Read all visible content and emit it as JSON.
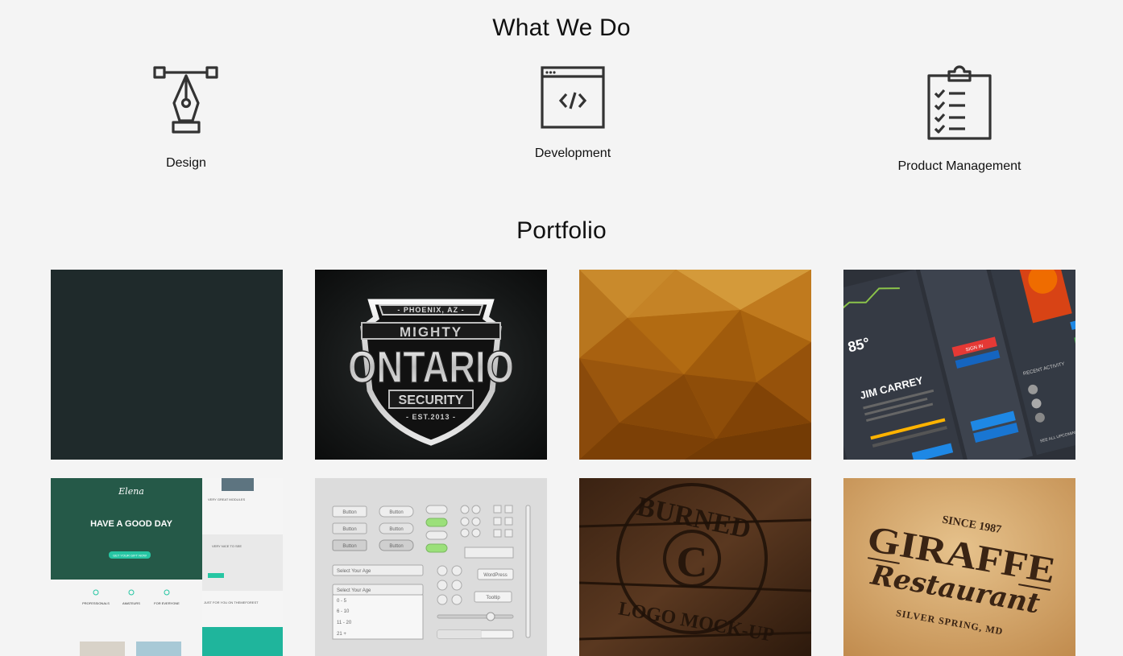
{
  "sections": {
    "what_we_do_title": "What We Do",
    "portfolio_title": "Portfolio"
  },
  "services": [
    {
      "label": "Design",
      "icon": "pen-nib-icon"
    },
    {
      "label": "Development",
      "icon": "code-window-icon"
    },
    {
      "label": "Product Management",
      "icon": "clipboard-checklist-icon"
    }
  ],
  "portfolio": {
    "ontario": {
      "top": "- PHOENIX, AZ -",
      "mighty": "MIGHTY",
      "name": "ONTARIO",
      "security": "SECURITY",
      "est": "- EST.2013 -"
    },
    "dashboard": {
      "temp": "85°",
      "name": "JIM CARREY",
      "signin": "SIGN IN",
      "recent": "RECENT ACTIVITY",
      "see_all": "SEE ALL UPCOMING ACTIVITY"
    },
    "elena": {
      "brand": "Elena",
      "headline": "HAVE A GOOD DAY",
      "cta": "GET YOUR GIFT NOW",
      "col1": "PROFESSIONALS",
      "col2": "AMATEURS",
      "col3": "FOR EVERYONE",
      "side1": "VERY GREAT MODULES",
      "side2": "VERY NICE TO SEE",
      "side3": "JUST FOR YOU ON THEMEFOREST"
    },
    "ui_kit": {
      "button": "Button",
      "select_age": "Select Your Age",
      "opt1": "0 - 5",
      "opt2": "6 - 10",
      "opt3": "11 - 20",
      "opt4": "21 +",
      "wordpress": "WordPress",
      "tooltip": "Tooltip"
    },
    "burned": {
      "top": "BURNED",
      "bottom": "LOGO MOCK-UP",
      "letter": "C"
    },
    "giraffe": {
      "since": "SINCE 1987",
      "name": "GIRAFFE",
      "sub": "Restaurant",
      "place": "SILVER SPRING, MD"
    }
  },
  "colors": {
    "background": "#f4f4f4",
    "text": "#111111",
    "icon_stroke": "#333333"
  }
}
